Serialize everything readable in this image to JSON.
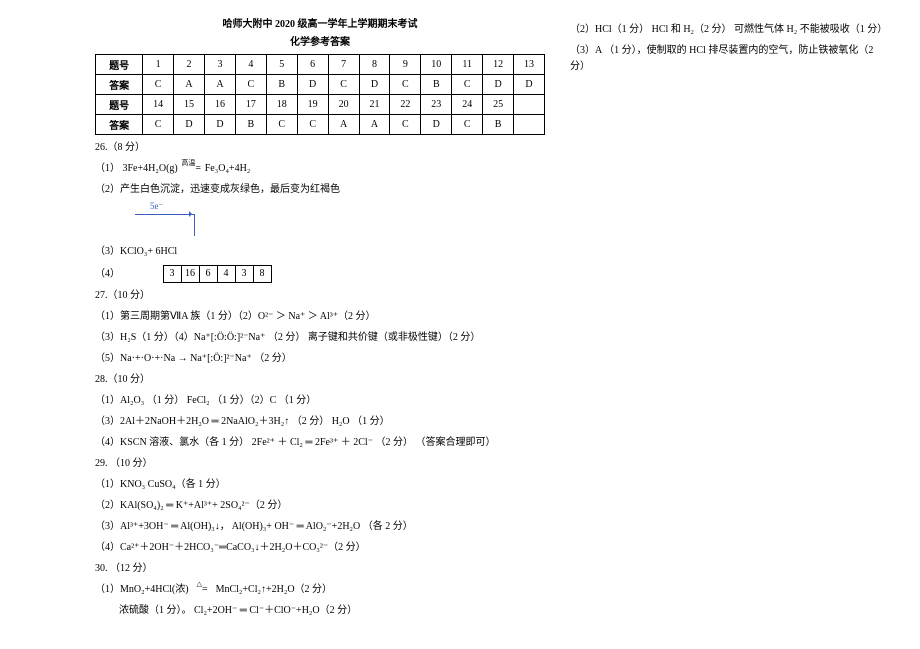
{
  "title": "哈师大附中 2020 级高一学年上学期期末考试",
  "subtitle": "化学参考答案",
  "table": {
    "row1_hdr": "题号",
    "row1": [
      "1",
      "2",
      "3",
      "4",
      "5",
      "6",
      "7",
      "8",
      "9",
      "10",
      "11",
      "12",
      "13"
    ],
    "row2_hdr": "答案",
    "row2": [
      "C",
      "A",
      "A",
      "C",
      "B",
      "D",
      "C",
      "D",
      "C",
      "B",
      "C",
      "D",
      "D"
    ],
    "row3_hdr": "题号",
    "row3": [
      "14",
      "15",
      "16",
      "17",
      "18",
      "19",
      "20",
      "21",
      "22",
      "23",
      "24",
      "25",
      ""
    ],
    "row4_hdr": "答案",
    "row4": [
      "C",
      "D",
      "D",
      "B",
      "C",
      "C",
      "A",
      "A",
      "C",
      "D",
      "C",
      "B",
      ""
    ]
  },
  "q26": {
    "header": "26.（8 分）",
    "p1_pre": "（1）",
    "p1_lhs": "3Fe+4H₂O(g)",
    "p1_cond": "高温",
    "p1_rhs": "Fe₃O₄+4H₂",
    "p2": "（2）产生白色沉淀，迅速变成灰绿色，最后变为红褐色",
    "label5e": "5e⁻",
    "p3": "（3）KClO₃+ 6HCl",
    "p4_label": "（4）",
    "boxes": [
      "3",
      "16",
      "6",
      "4",
      "3",
      "8"
    ]
  },
  "q27": {
    "header": "27.（10 分）",
    "p1": "（1）第三周期第ⅦA 族（1 分）（2）O²⁻ ＞ Na⁺ ＞ Al³⁺（2 分）",
    "p3": "（3）H₂S（1 分）（4）Na⁺[:Ö:Ö:]²⁻Na⁺ （2 分）     离子键和共价键（或非极性键）（2 分）",
    "p5": "（5）Na·+·O·+·Na → Na⁺[:Ö:]²⁻Na⁺   （2 分）"
  },
  "q28": {
    "header": "28.（10 分）",
    "p1": "（1）Al₂O₃ （1 分）     FeCl₂ （1 分）（2）C  （1 分）",
    "p3": "（3）2Al＋2NaOH＋2H₂O ═ 2NaAlO₂＋3H₂↑ （2 分）    H₂O  （1 分）",
    "p4": "（4）KSCN 溶液、氯水（各 1 分）   2Fe²⁺ ＋ Cl₂ ═ 2Fe³⁺ ＋ 2Cl⁻  （2 分） （答案合理即可）"
  },
  "q29": {
    "header": "29. （10 分）",
    "p1": "（1）KNO₃       CuSO₄（各 1 分）",
    "p2": "（2）KAl(SO₄)₂ ═ K⁺+Al³⁺+ 2SO₄²⁻（2 分）",
    "p3": "（3）Al³⁺+3OH⁻ ═ Al(OH)₃↓，  Al(OH)₃+ OH⁻ ═ AlO₂⁻+2H₂O （各 2 分）",
    "p4": "（4）Ca²⁺＋2OH⁻＋2HCO₃⁻═CaCO₃↓＋2H₂O＋CO₃²⁻（2 分）"
  },
  "q30": {
    "header": "30. （12 分）",
    "p1a": "（1）MnO₂+4HCl(浓)",
    "p1cond": "△",
    "p1b": "MnCl₂+Cl₂↑+2H₂O（2 分）",
    "p1c": "浓硫酸（1 分）。       Cl₂+2OH⁻ ═ Cl⁻＋ClO⁻+H₂O（2 分）"
  },
  "right": {
    "p2": "（2）HCl（1 分）   HCl 和 H₂（2 分）   可燃性气体 H₂ 不能被吸收（1 分）",
    "p3": "（3）A  （1 分），使制取的 HCl 排尽装置内的空气，防止铁被氧化（2 分）"
  }
}
